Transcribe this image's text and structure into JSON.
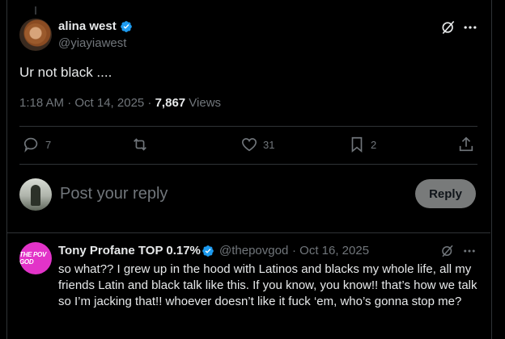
{
  "main_post": {
    "author_name": "alina west",
    "author_handle": "@yiayiawest",
    "text": "Ur not black ....",
    "time": "1:18 AM · Oct 14, 2025 · ",
    "views_count": "7,867",
    "views_label": " Views",
    "replies": "7",
    "reposts": "",
    "likes": "31",
    "bookmarks": "2"
  },
  "reply_composer": {
    "placeholder": "Post your reply",
    "button_label": "Reply"
  },
  "reply_post": {
    "author_name": "Tony Profane TOP 0.17%",
    "author_handle": "@thepovgod",
    "date": "· Oct 16, 2025",
    "avatar_text": "THE POV GOD",
    "text": "so what?? I grew up in the hood with Latinos and blacks my whole life, all my friends Latin and black talk like this. If you know, you know!! that’s how we talk so I’m jacking that!! whoever doesn’t like it fuck ‘em, who’s gonna stop me?"
  },
  "colors": {
    "verified": "#1d9bf0",
    "muted": "#71767b",
    "text": "#e7e9ea",
    "divider": "#2f3336"
  }
}
